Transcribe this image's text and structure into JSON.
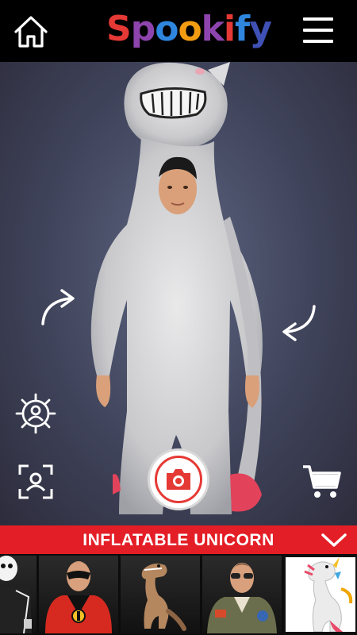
{
  "app": {
    "logo_letters": [
      "S",
      "p",
      "o",
      "o",
      "k",
      "i",
      "f",
      "y"
    ],
    "logo_colors": [
      "#e53935",
      "#8e44ad",
      "#2e86de",
      "#f39c12",
      "#8e44ad",
      "#e53935",
      "#2e86de",
      "#3f51b5"
    ]
  },
  "header": {
    "home_icon": "home-icon",
    "menu_icon": "hamburger-menu-icon"
  },
  "stage": {
    "rotate_left_icon": "rotate-left-icon",
    "rotate_right_icon": "rotate-right-icon",
    "settings_icon": "face-settings-icon",
    "face_icon": "face-frame-icon",
    "camera_icon": "camera-icon",
    "cart_icon": "shopping-cart-icon"
  },
  "costume": {
    "title": "INFLATABLE UNICORN",
    "accent": "#e41e26"
  },
  "carousel": {
    "items": [
      {
        "name": "skeleton-costume",
        "selected": false
      },
      {
        "name": "superhero-costume",
        "selected": false
      },
      {
        "name": "inflatable-dinosaur-costume",
        "selected": false
      },
      {
        "name": "pilot-costume",
        "selected": false
      },
      {
        "name": "inflatable-unicorn-costume",
        "selected": true
      }
    ]
  }
}
